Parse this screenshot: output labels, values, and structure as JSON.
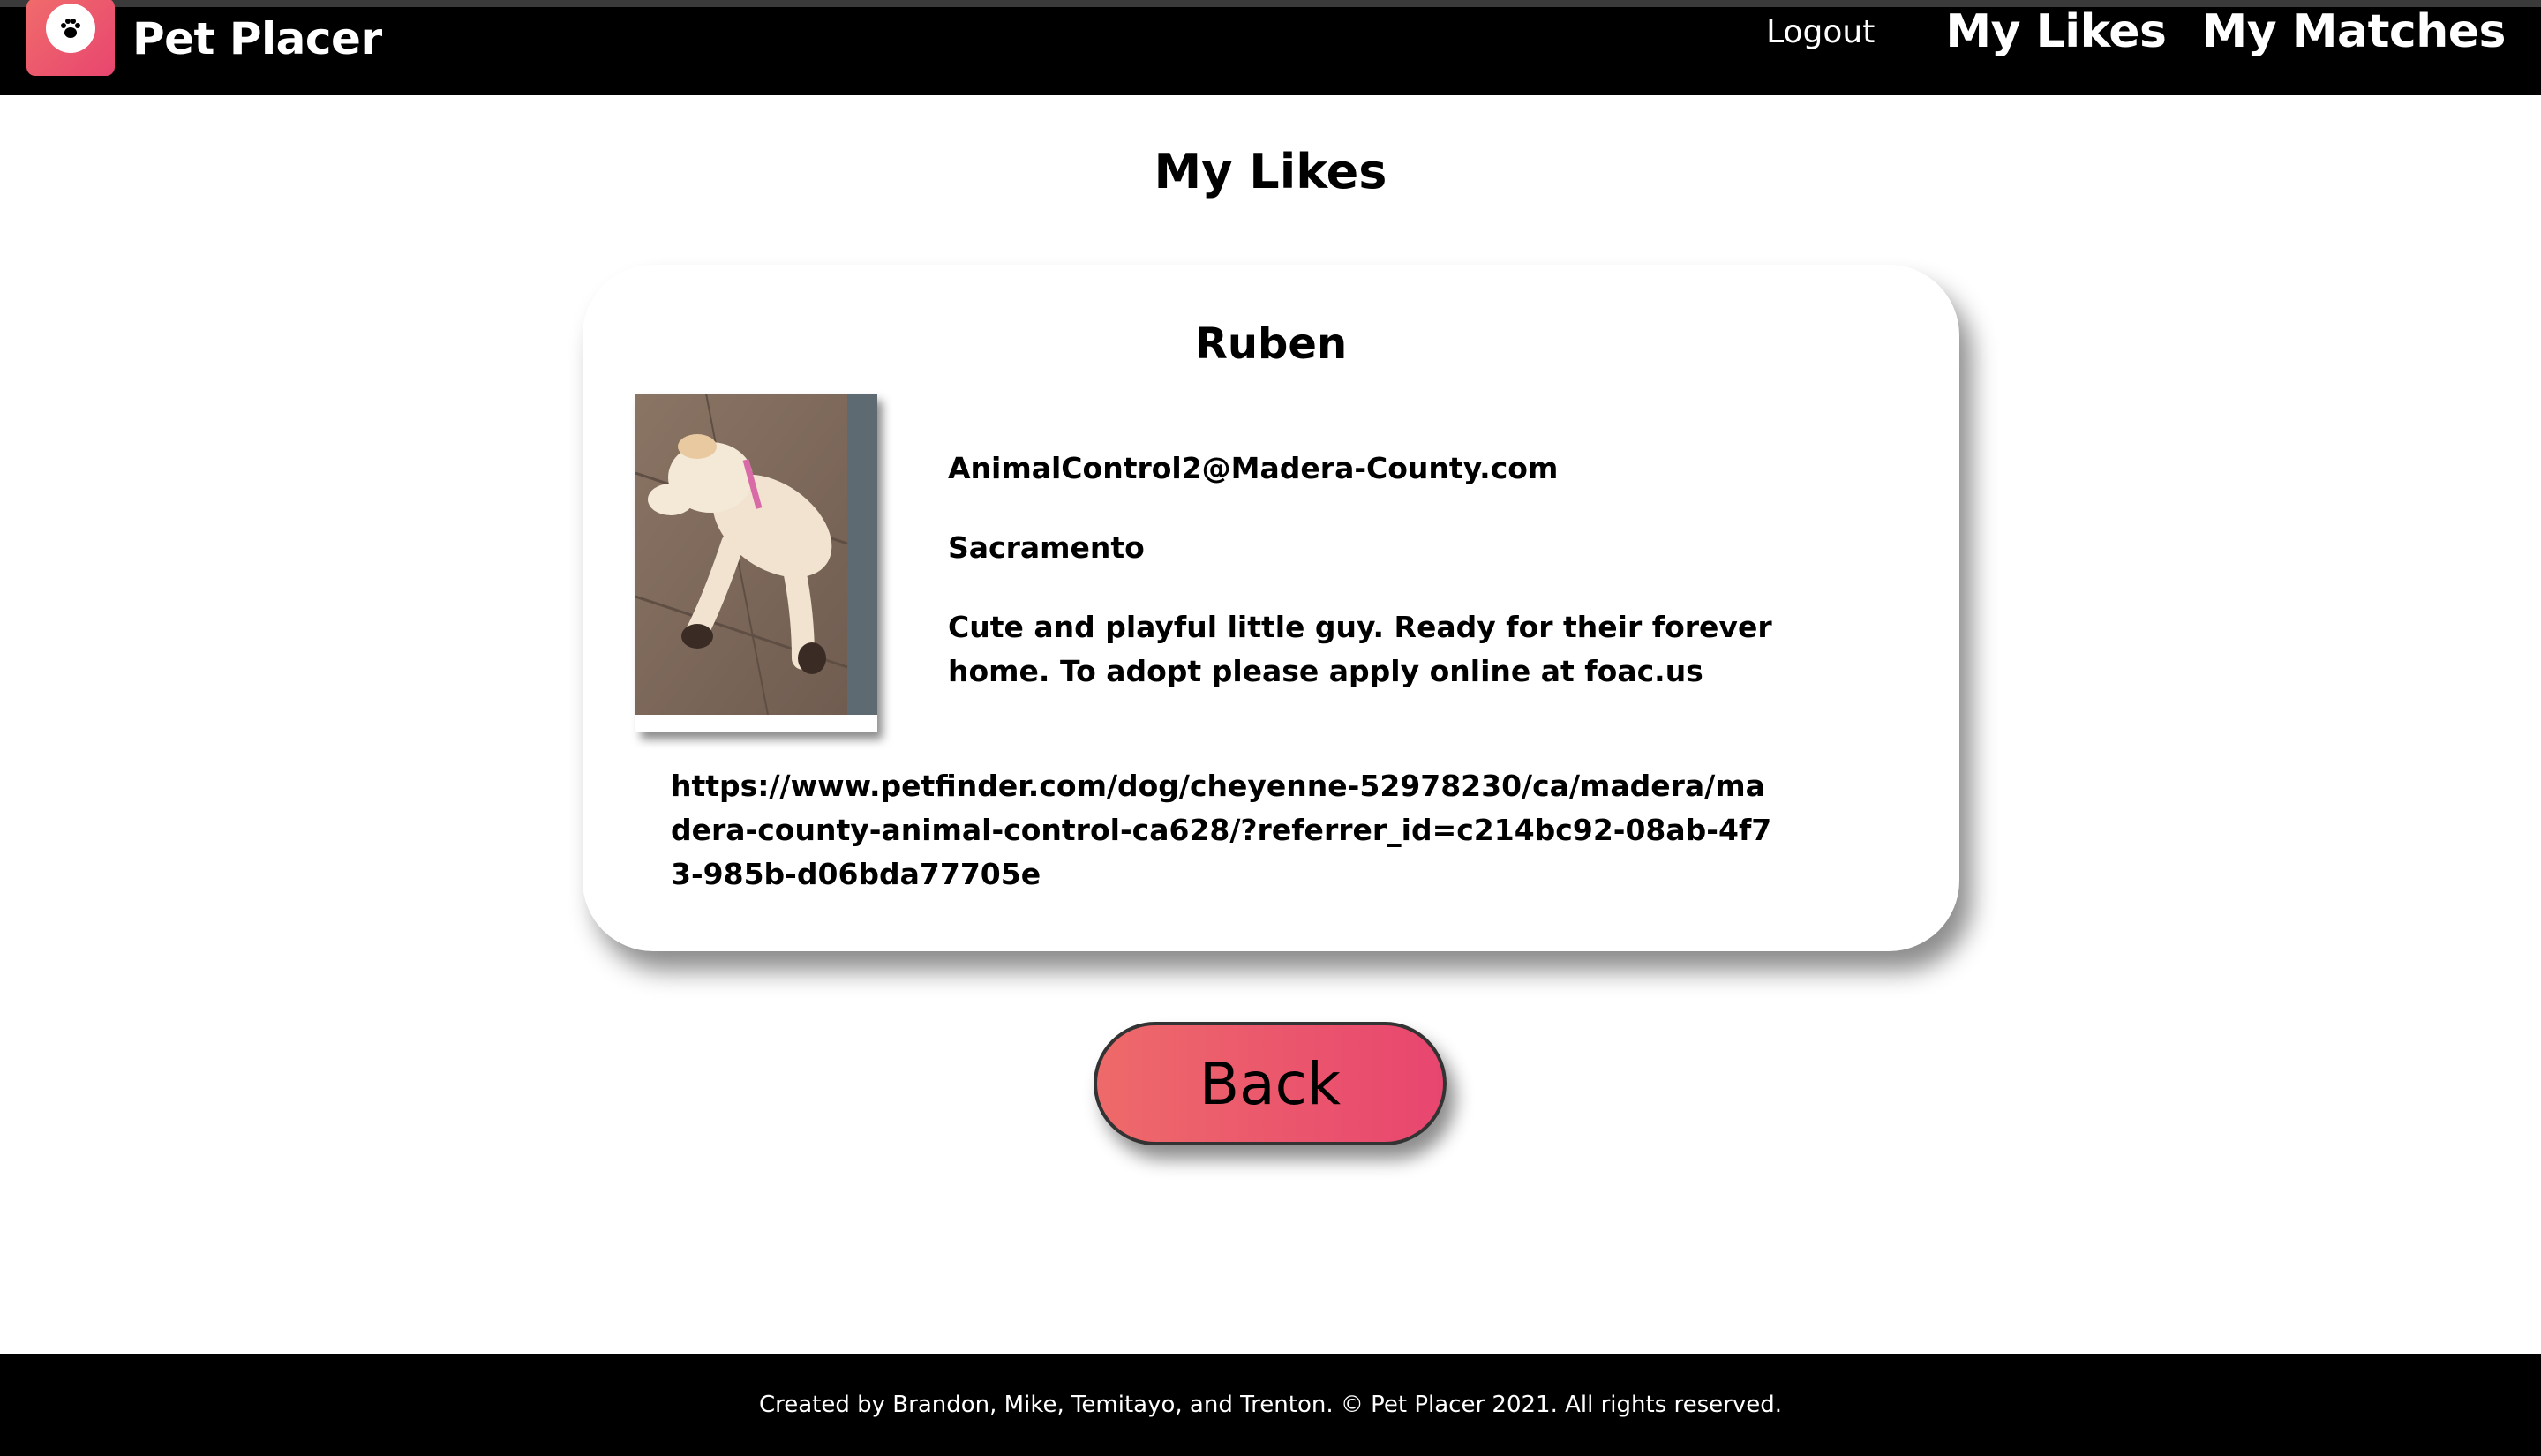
{
  "header": {
    "brand_name": "Pet Placer",
    "logo_icon": "paw-icon",
    "nav": {
      "logout": "Logout",
      "my_likes": "My Likes",
      "my_matches": "My Matches"
    }
  },
  "page": {
    "title": "My Likes"
  },
  "pet": {
    "name": "Ruben",
    "email": "AnimalControl2@Madera-County.com",
    "city": "Sacramento",
    "description": "Cute and playful little guy. Ready for their forever home. To adopt please apply online at foac.us",
    "url": "https://www.petfinder.com/dog/cheyenne-52978230/ca/madera/madera-county-animal-control-ca628/?referrer_id=c214bc92-08ab-4f73-985b-d06bda77705e"
  },
  "actions": {
    "back_label": "Back"
  },
  "footer": {
    "text": "Created by Brandon, Mike, Temitayo, and Trenton. © Pet Placer 2021. All rights reserved."
  },
  "colors": {
    "accent_start": "#ee6a6a",
    "accent_end": "#e8466f",
    "nav_background": "#000000"
  }
}
